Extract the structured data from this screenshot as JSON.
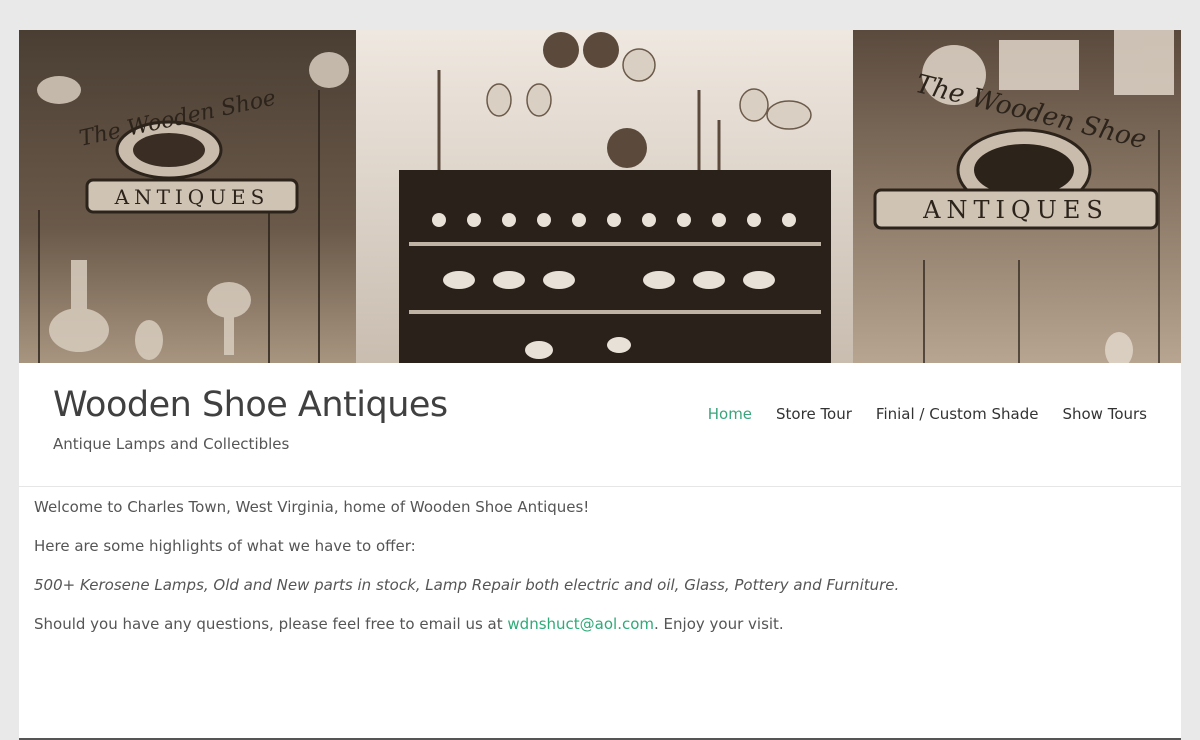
{
  "banner": {
    "left_sign_text": "The Wooden Shoe",
    "left_sign_label": "ANTIQUES",
    "right_sign_text": "The Wooden Shoe",
    "right_sign_label": "ANTIQUES"
  },
  "header": {
    "site_title": "Wooden Shoe Antiques",
    "tagline": "Antique Lamps and Collectibles"
  },
  "nav": {
    "items": [
      {
        "label": "Home",
        "active": true
      },
      {
        "label": "Store Tour",
        "active": false
      },
      {
        "label": "Finial / Custom Shade",
        "active": false
      },
      {
        "label": "Show Tours",
        "active": false
      }
    ]
  },
  "content": {
    "p1": "Welcome to Charles Town, West Virginia, home of Wooden Shoe Antiques!",
    "p2": "Here are some highlights of what we have to offer:",
    "p3": "500+ Kerosene Lamps, Old and New parts in stock, Lamp Repair both electric and oil, Glass, Pottery and Furniture.",
    "p4_before": "Should you have any questions, please feel free to email us at ",
    "p4_email": "wdnshuct@aol.com",
    "p4_after": ". Enjoy your visit."
  },
  "colors": {
    "accent": "#3aa57c",
    "text": "#555555",
    "title": "#404040",
    "background": "#e9e9e9"
  }
}
